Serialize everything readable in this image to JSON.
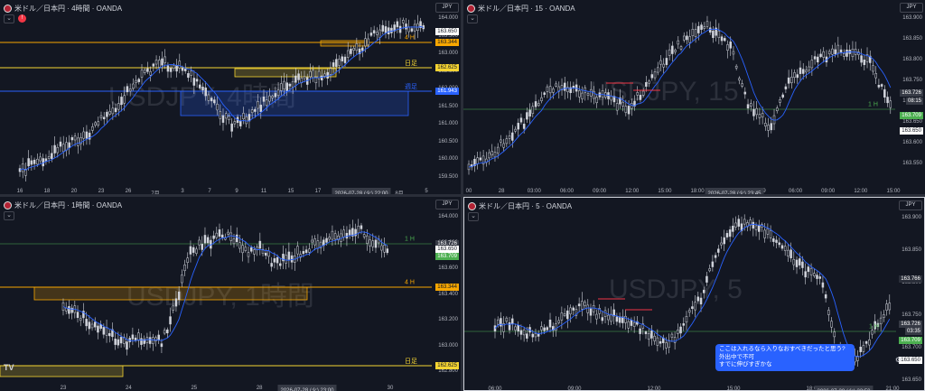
{
  "colors": {
    "bg": "#131722",
    "candle": "#d1d4dc",
    "ma": "#2962ff",
    "orange": "#f7a600",
    "yellow": "#f5d432",
    "blue": "#2962ff",
    "green": "#4caf50",
    "callout": "#2962ff"
  },
  "panes": [
    {
      "title": "米ドル／日本円 · 4時間 · OANDA",
      "currency": "JPY",
      "watermark": "USDJPY, 4時間",
      "y_ticks": [
        "164.000",
        "163.500",
        "163.000",
        "162.500",
        "162.000",
        "161.500",
        "161.000",
        "160.500",
        "160.000",
        "159.500"
      ],
      "x_ticks": [
        "16",
        "18",
        "20",
        "23",
        "26",
        "7月",
        "3",
        "7",
        "9",
        "11",
        "15",
        "17",
        "21",
        "23",
        "8月",
        "5"
      ],
      "crosshair": "2026-07-28 (火)   22:00",
      "price_tags": [
        {
          "text": "163.650",
          "kind": "price"
        },
        {
          "text": "163.344",
          "kind": "orange"
        },
        {
          "text": "162.625",
          "kind": "yellow"
        },
        {
          "text": "161.943",
          "kind": "blue"
        }
      ],
      "levels": [
        {
          "text": "4 H",
          "kind": "orange"
        },
        {
          "text": "日足",
          "kind": "yellow"
        },
        {
          "text": "週足",
          "kind": "blue"
        }
      ]
    },
    {
      "title": "米ドル／日本円 · 15 · OANDA",
      "currency": "JPY",
      "watermark": "USDJPY, 15",
      "y_ticks": [
        "163.900",
        "163.850",
        "163.800",
        "163.750",
        "163.700",
        "163.650",
        "163.600",
        "163.550"
      ],
      "x_ticks": [
        "00",
        "28",
        "03:00",
        "06:00",
        "09:00",
        "12:00",
        "15:00",
        "18:00",
        "21:00",
        "29",
        "06:00",
        "09:00",
        "12:00",
        "15:00"
      ],
      "crosshair": "2026-07-28 (火)   23:45",
      "price_tags": [
        {
          "text": "163.726",
          "kind": "price2"
        },
        {
          "text": "08:15",
          "kind": "price2"
        },
        {
          "text": "163.709",
          "kind": "green"
        },
        {
          "text": "163.650",
          "kind": "price"
        }
      ],
      "levels": [
        {
          "text": "1 H",
          "kind": "green"
        }
      ]
    },
    {
      "title": "米ドル／日本円 · 1時間 · OANDA",
      "currency": "JPY",
      "watermark": "USDJPY, 1時間",
      "y_ticks": [
        "164.000",
        "163.800",
        "163.600",
        "163.400",
        "163.200",
        "163.000",
        "162.800",
        "162.600"
      ],
      "x_ticks": [
        "23",
        "24",
        "25",
        "28",
        "29",
        "30"
      ],
      "crosshair": "2026-07-28 (火)   23:00",
      "price_tags": [
        {
          "text": "163.726",
          "kind": "price2"
        },
        {
          "text": "163.650",
          "kind": "price"
        },
        {
          "text": "163.709",
          "kind": "green"
        },
        {
          "text": "163.344",
          "kind": "orange"
        },
        {
          "text": "162.625",
          "kind": "yellow"
        }
      ],
      "levels": [
        {
          "text": "1 H",
          "kind": "green"
        },
        {
          "text": "4 H",
          "kind": "orange"
        },
        {
          "text": "日足",
          "kind": "yellow"
        }
      ],
      "logo": "TV"
    },
    {
      "title": "米ドル／日本円 · 5 · OANDA",
      "currency": "JPY",
      "watermark": "USDJPY, 5",
      "y_ticks": [
        "163.900",
        "163.850",
        "163.800",
        "163.750",
        "163.700",
        "163.650"
      ],
      "x_ticks": [
        "06:00",
        "09:00",
        "12:00",
        "15:00",
        "18:00",
        "21:00"
      ],
      "crosshair": "2026-07-28 (火)   23:50",
      "price_tags": [
        {
          "text": "163.766",
          "kind": "faint"
        },
        {
          "text": "163.726",
          "kind": "price2"
        },
        {
          "text": "03:35",
          "kind": "price2"
        },
        {
          "text": "163.709",
          "kind": "green"
        },
        {
          "text": "163.650",
          "kind": "price"
        }
      ],
      "levels": [
        {
          "text": "1 H",
          "kind": "green"
        }
      ],
      "callout": [
        "ここは入れるなら入りなおすべきだったと思う?",
        "外出中で不可",
        "すでに伸びすぎかな"
      ]
    }
  ]
}
